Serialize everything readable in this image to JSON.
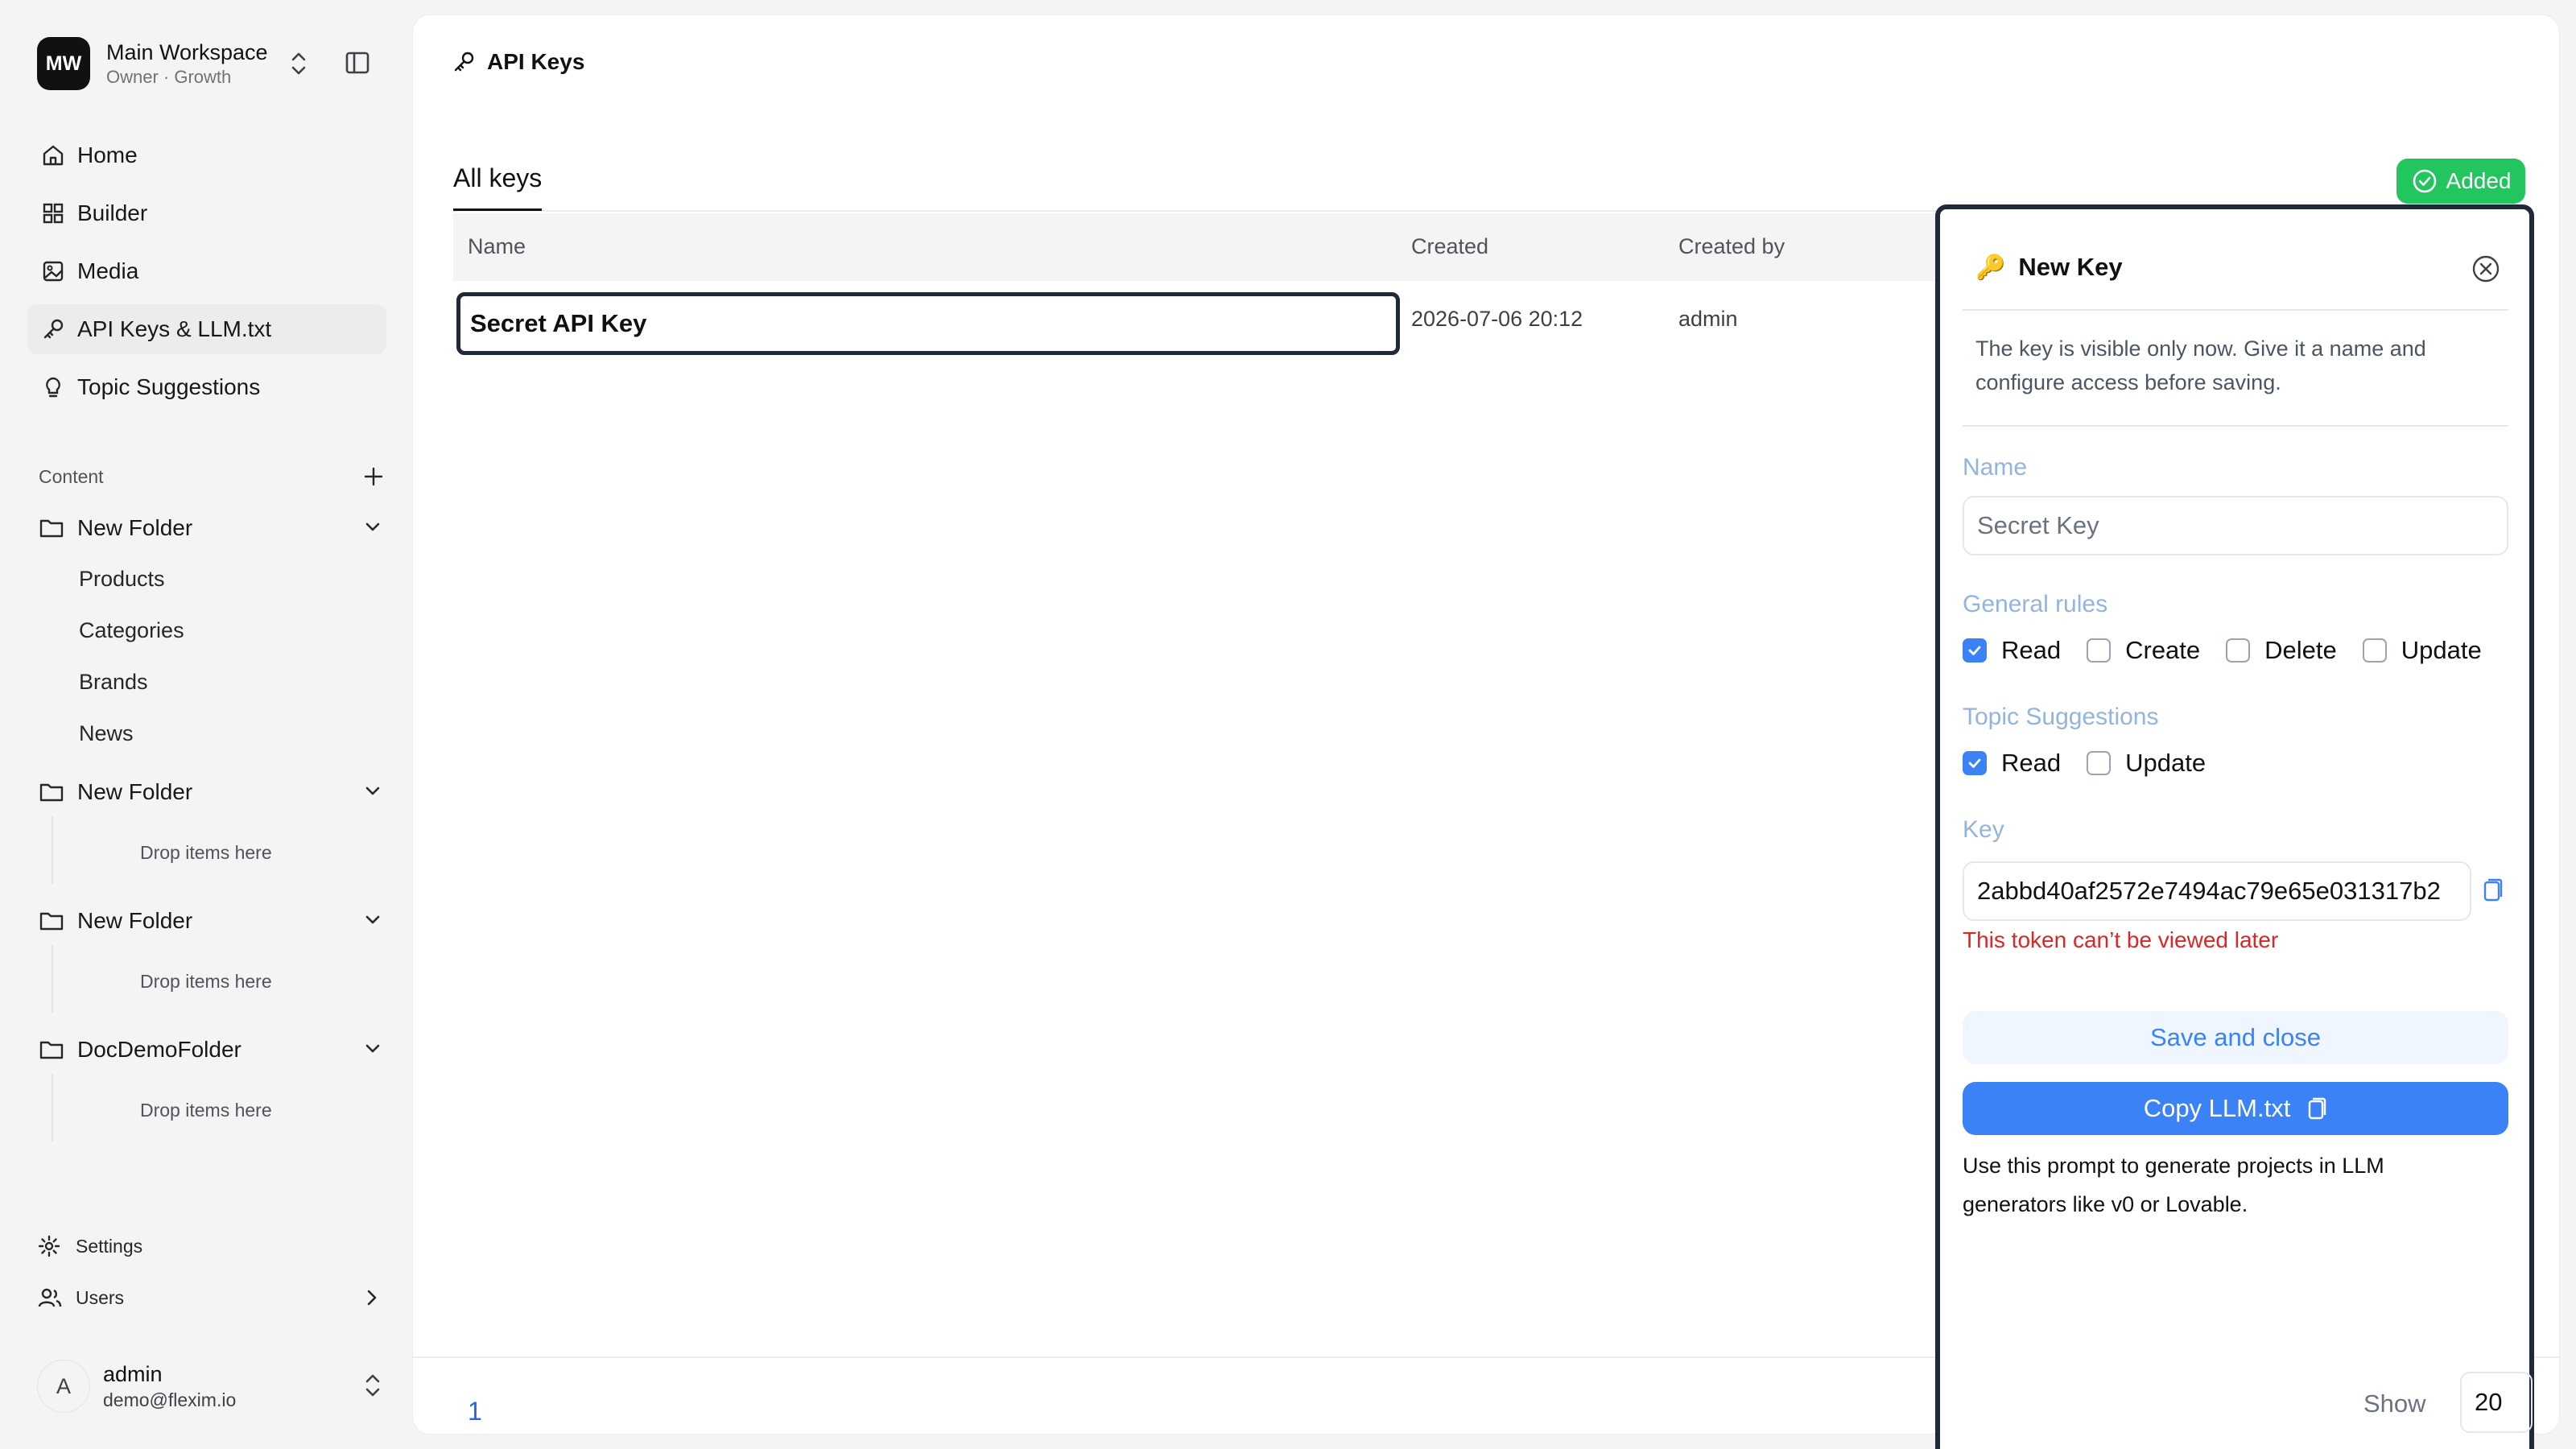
{
  "workspace": {
    "initials": "MW",
    "name": "Main Workspace",
    "subtitle": "Owner · Growth"
  },
  "nav": [
    {
      "label": "Home",
      "icon": "home-icon"
    },
    {
      "label": "Builder",
      "icon": "grid-icon"
    },
    {
      "label": "Media",
      "icon": "image-icon"
    },
    {
      "label": "API Keys & LLM.txt",
      "icon": "key-icon",
      "active": true
    },
    {
      "label": "Topic Suggestions",
      "icon": "lightbulb-icon"
    }
  ],
  "content": {
    "heading": "Content",
    "folders": [
      {
        "label": "New Folder",
        "children": [
          "Products",
          "Categories",
          "Brands",
          "News"
        ]
      },
      {
        "label": "New Folder",
        "drop": "Drop items here"
      },
      {
        "label": "New Folder",
        "drop": "Drop items here"
      },
      {
        "label": "DocDemoFolder",
        "drop": "Drop items here"
      }
    ]
  },
  "bottom": {
    "settings": "Settings",
    "users": "Users"
  },
  "user": {
    "initial": "A",
    "name": "admin",
    "email": "demo@flexim.io"
  },
  "page": {
    "title": "API Keys",
    "tab": "All keys",
    "columns": {
      "name": "Name",
      "created": "Created",
      "created_by": "Created by"
    },
    "rows": [
      {
        "name": "Secret API Key",
        "created": "2026-07-06 20:12",
        "created_by": "admin"
      }
    ],
    "badge": "Added",
    "pagination": {
      "page": "1"
    }
  },
  "drawer": {
    "title": "New Key",
    "description": "The key is visible only now. Give it a name and configure access before saving.",
    "name_label": "Name",
    "name_placeholder": "Secret Key",
    "general_label": "General rules",
    "general_rules": [
      {
        "label": "Read",
        "checked": true
      },
      {
        "label": "Create",
        "checked": false
      },
      {
        "label": "Delete",
        "checked": false
      },
      {
        "label": "Update",
        "checked": false
      }
    ],
    "topic_label": "Topic Suggestions",
    "topic_rules": [
      {
        "label": "Read",
        "checked": true
      },
      {
        "label": "Update",
        "checked": false
      }
    ],
    "key_label": "Key",
    "key_value": "2abbd40af2572e7494ac79e65e031317b2",
    "warning": "This token can’t be viewed later",
    "save_label": "Save and close",
    "copy_label": "Copy LLM.txt",
    "prompt": "Use this prompt to generate projects in LLM generators like v0 or Lovable.",
    "show_label": "Show",
    "show_value": "20"
  },
  "colors": {
    "accent": "#3b82f6",
    "success": "#22c55e",
    "danger": "#dc2626",
    "label": "#93b4dd"
  }
}
